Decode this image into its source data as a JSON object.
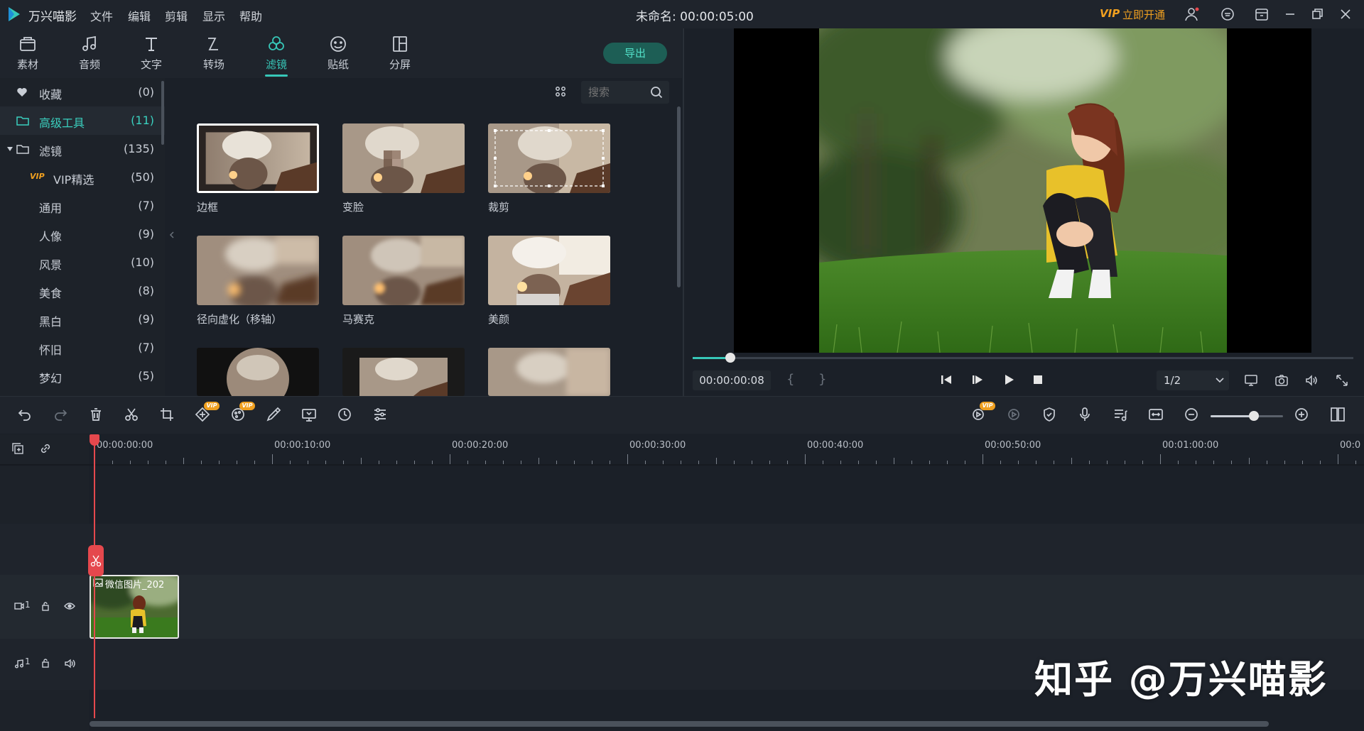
{
  "app": {
    "name": "万兴喵影",
    "menu": [
      "文件",
      "编辑",
      "剪辑",
      "显示",
      "帮助"
    ],
    "project_title": "未命名: 00:00:05:00",
    "vip_text": "立即开通",
    "vip_badge": "VIP"
  },
  "tabs": [
    {
      "label": "素材",
      "icon": "media-folder-icon"
    },
    {
      "label": "音频",
      "icon": "music-note-icon"
    },
    {
      "label": "文字",
      "icon": "text-T-icon"
    },
    {
      "label": "转场",
      "icon": "transition-icon"
    },
    {
      "label": "滤镜",
      "icon": "filter-circles-icon"
    },
    {
      "label": "贴纸",
      "icon": "sticker-smile-icon"
    },
    {
      "label": "分屏",
      "icon": "split-screen-icon"
    }
  ],
  "active_tab": "滤镜",
  "export_label": "导出",
  "sidebar": {
    "items": [
      {
        "name": "收藏",
        "count": "(0)"
      },
      {
        "name": "高级工具",
        "count": "(11)"
      },
      {
        "name": "滤镜",
        "count": "(135)"
      },
      {
        "name": "VIP精选",
        "count": "(50)"
      },
      {
        "name": "通用",
        "count": "(7)"
      },
      {
        "name": "人像",
        "count": "(9)"
      },
      {
        "name": "风景",
        "count": "(10)"
      },
      {
        "name": "美食",
        "count": "(8)"
      },
      {
        "name": "黑白",
        "count": "(9)"
      },
      {
        "name": "怀旧",
        "count": "(7)"
      },
      {
        "name": "梦幻",
        "count": "(5)"
      }
    ]
  },
  "search": {
    "placeholder": "搜索"
  },
  "filters": [
    {
      "label": "边框"
    },
    {
      "label": "变脸"
    },
    {
      "label": "裁剪"
    },
    {
      "label": "径向虚化（移轴）"
    },
    {
      "label": "马赛克"
    },
    {
      "label": "美颜"
    },
    {
      "label": ""
    },
    {
      "label": ""
    },
    {
      "label": ""
    }
  ],
  "player": {
    "timecode": "00:00:00:08",
    "bracket_in": "{",
    "bracket_out": "}",
    "quality": "1/2",
    "progress_fraction": 0.057
  },
  "timeline": {
    "ruler_labels": [
      "00:00:00:00",
      "00:00:10:00",
      "00:00:20:00",
      "00:00:30:00",
      "00:00:40:00",
      "00:00:50:00",
      "00:01:00:00",
      "00:0"
    ],
    "video_track_label": "1",
    "audio_track_label": "1",
    "clip_name": "微信图片_202",
    "zoom_fraction": 0.6
  },
  "watermark": "知乎 @万兴喵影",
  "colors": {
    "accent": "#37c7b8",
    "playhead": "#e5484d",
    "vip": "#f0a020"
  }
}
